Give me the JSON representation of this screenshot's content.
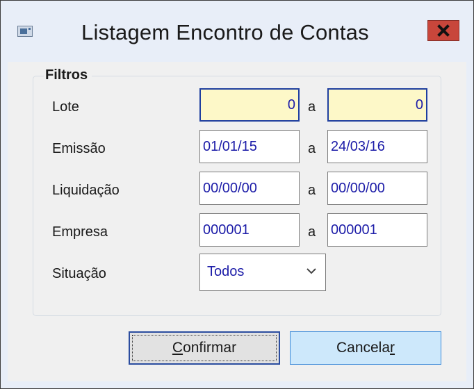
{
  "window": {
    "title": "Listagem Encontro de Contas",
    "close_label": "×"
  },
  "filters": {
    "legend": "Filtros",
    "rows": [
      {
        "label": "Lote",
        "from": "0",
        "sep": "a",
        "to": "0"
      },
      {
        "label": "Emissão",
        "from": "01/01/15",
        "sep": "a",
        "to": "24/03/16"
      },
      {
        "label": "Liquidação",
        "from": "00/00/00",
        "sep": "a",
        "to": "00/00/00"
      },
      {
        "label": "Empresa",
        "from": "000001",
        "sep": "a",
        "to": "000001"
      }
    ],
    "situacao": {
      "label": "Situação",
      "value": "Todos"
    }
  },
  "buttons": {
    "confirm": {
      "mnemonic": "C",
      "rest": "onfirmar"
    },
    "cancel": {
      "prefix": "Cancela",
      "mnemonic": "r"
    }
  },
  "colors": {
    "title_bg": "#e8eef8",
    "close_bg": "#c8463b",
    "input_text": "#1c1ca8",
    "lote_bg": "#fdf8c8",
    "cancel_bg": "#cde8fb"
  }
}
